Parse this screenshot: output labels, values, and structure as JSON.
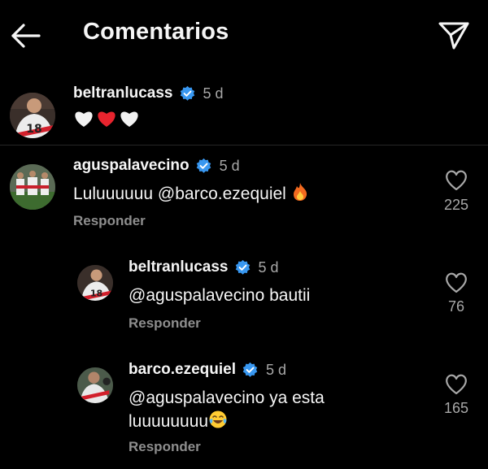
{
  "header": {
    "title": "Comentarios",
    "back_icon": "arrow-left-icon",
    "send_icon": "paper-plane-icon"
  },
  "caption": {
    "username": "beltranlucass",
    "time": "5 d",
    "text_emojis": [
      "white-heart-icon",
      "red-heart-icon",
      "white-heart-icon"
    ]
  },
  "comments": [
    {
      "username": "aguspalavecino",
      "time": "5 d",
      "text": "Luluuuuuu @barco.ezequiel ",
      "emoji": "fire-icon",
      "reply_label": "Responder",
      "likes": "225"
    }
  ],
  "replies": [
    {
      "username": "beltranlucass",
      "time": "5 d",
      "text": "@aguspalavecino bautii",
      "reply_label": "Responder",
      "likes": "76"
    },
    {
      "username": "barco.ezequiel",
      "time": "5 d",
      "text_line1": "@aguspalavecino ya esta",
      "text_line2": "luuuuuuuu",
      "emoji": "tears-of-joy-icon",
      "reply_label": "Responder",
      "likes": "165"
    }
  ],
  "colors": {
    "background": "#000000",
    "text": "#f5f5f5",
    "muted": "#a8a8a8",
    "verified": "#3897f0",
    "divider": "#262626"
  }
}
